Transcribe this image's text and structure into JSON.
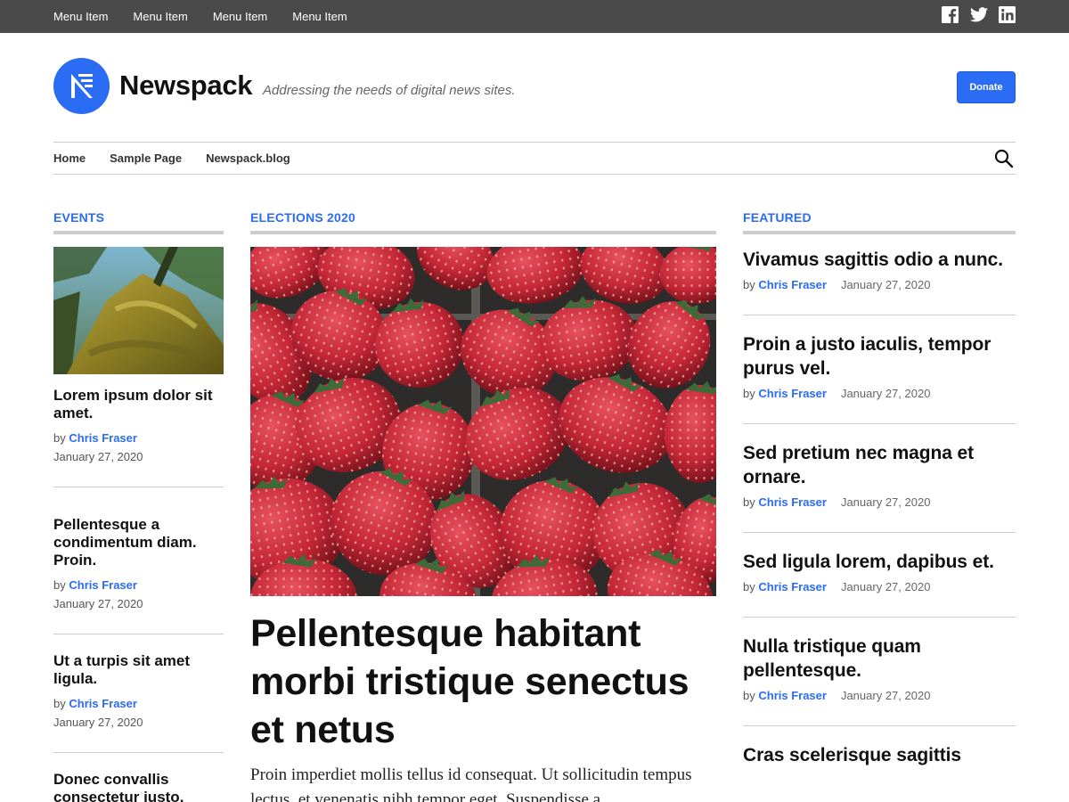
{
  "topbar": {
    "menu": [
      "Menu Item",
      "Menu Item",
      "Menu Item",
      "Menu Item"
    ],
    "social_icons": [
      "facebook-icon",
      "twitter-icon",
      "linkedin-icon"
    ]
  },
  "header": {
    "site_title": "Newspack",
    "tagline": "Addressing the needs of digital news sites.",
    "donate_label": "Donate"
  },
  "nav": {
    "items": [
      "Home",
      "Sample Page",
      "Newspack.blog"
    ]
  },
  "colors": {
    "accent": "#2a6cf3",
    "topbar": "#4a4a4a",
    "rule": "#cccccc"
  },
  "events": {
    "heading": "EVENTS",
    "posts": [
      {
        "title": "Lorem ipsum dolor sit amet.",
        "by": "by",
        "author": "Chris Fraser",
        "date": "January 27, 2020"
      },
      {
        "title": "Pellentesque a condimentum diam. Proin.",
        "by": "by",
        "author": "Chris Fraser",
        "date": "January 27, 2020"
      },
      {
        "title": "Ut a turpis sit amet ligula.",
        "by": "by",
        "author": "Chris Fraser",
        "date": "January 27, 2020"
      },
      {
        "title": "Donec convallis consectetur justo.",
        "by": "",
        "author": "",
        "date": ""
      }
    ]
  },
  "elections": {
    "heading": "ELECTIONS 2020",
    "title": "Pellentesque habitant morbi tristique senectus et netus",
    "excerpt": "Proin imperdiet mollis tellus id consequat. Ut sollicitudin tempus lectus, et venenatis nibh tempor eget. Suspendisse a"
  },
  "featured": {
    "heading": "FEATURED",
    "posts": [
      {
        "title": "Vivamus sagittis odio a nunc.",
        "by": "by",
        "author": "Chris Fraser",
        "date": "January 27, 2020"
      },
      {
        "title": "Proin a justo iaculis, tempor purus vel.",
        "by": "by",
        "author": "Chris Fraser",
        "date": "January 27, 2020"
      },
      {
        "title": "Sed pretium nec magna et ornare.",
        "by": "by",
        "author": "Chris Fraser",
        "date": "January 27, 2020"
      },
      {
        "title": "Sed ligula lorem, dapibus et.",
        "by": "by",
        "author": "Chris Fraser",
        "date": "January 27, 2020"
      },
      {
        "title": "Nulla tristique quam pellentesque.",
        "by": "by",
        "author": "Chris Fraser",
        "date": "January 27, 2020"
      },
      {
        "title": "Cras scelerisque sagittis",
        "by": "",
        "author": "",
        "date": ""
      }
    ]
  }
}
